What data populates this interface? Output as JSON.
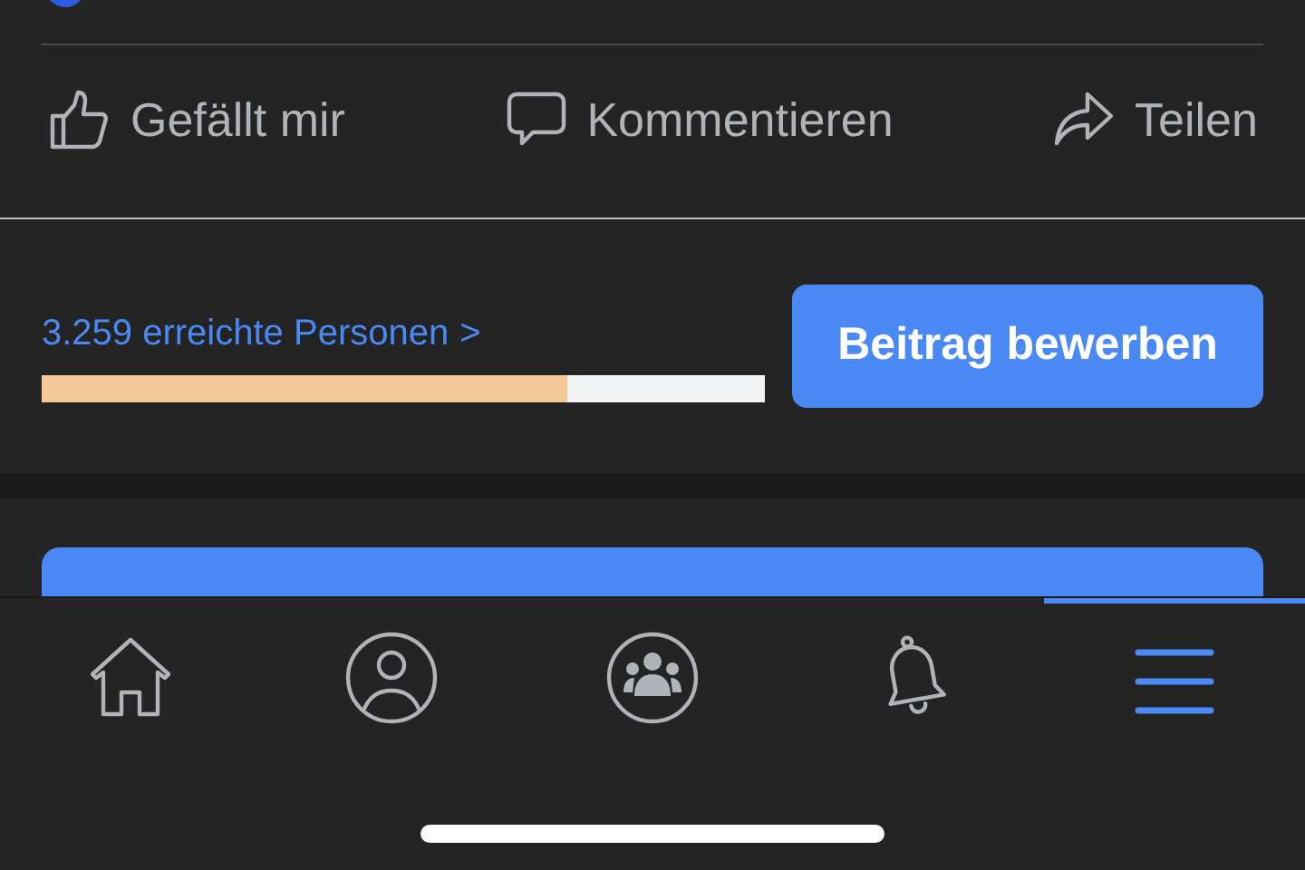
{
  "actions": [
    {
      "kind": "like",
      "label": "Gefällt mir"
    },
    {
      "kind": "comment",
      "label": "Kommentieren"
    },
    {
      "kind": "share",
      "label": "Teilen"
    }
  ],
  "reach": {
    "label": "3.259 erreichte Personen",
    "chevron": ">",
    "level": 0.727
  },
  "promote_button": "Beitrag bewerben",
  "tab_bar": [
    {
      "kind": "home",
      "selected": false
    },
    {
      "kind": "profile",
      "selected": false
    },
    {
      "kind": "groups",
      "selected": false
    },
    {
      "kind": "notifications",
      "selected": false
    },
    {
      "kind": "menu",
      "selected": true
    }
  ]
}
